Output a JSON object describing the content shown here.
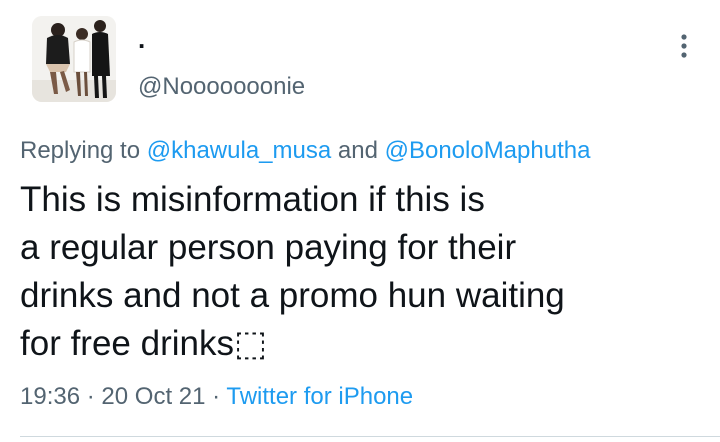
{
  "author": {
    "display_name": ".",
    "handle": "@Nooooooonie"
  },
  "reply": {
    "prefix": "Replying to",
    "mention1": "@khawula_musa",
    "conjunction": "and",
    "mention2": "@BonoloMaphutha"
  },
  "tweet": {
    "lines": [
      "This is misinformation if this is",
      "a regular person paying for their",
      "drinks and not a promo hun waiting",
      "for free drinks⬚"
    ]
  },
  "meta": {
    "time": "19:36",
    "separator": "·",
    "date": "20 Oct 21",
    "source": "Twitter for iPhone"
  },
  "icons": {
    "more": "more-vertical-icon"
  },
  "colors": {
    "link": "#1d9bf0",
    "secondary": "#536471",
    "text": "#0f1419",
    "divider": "#cfd9de"
  }
}
